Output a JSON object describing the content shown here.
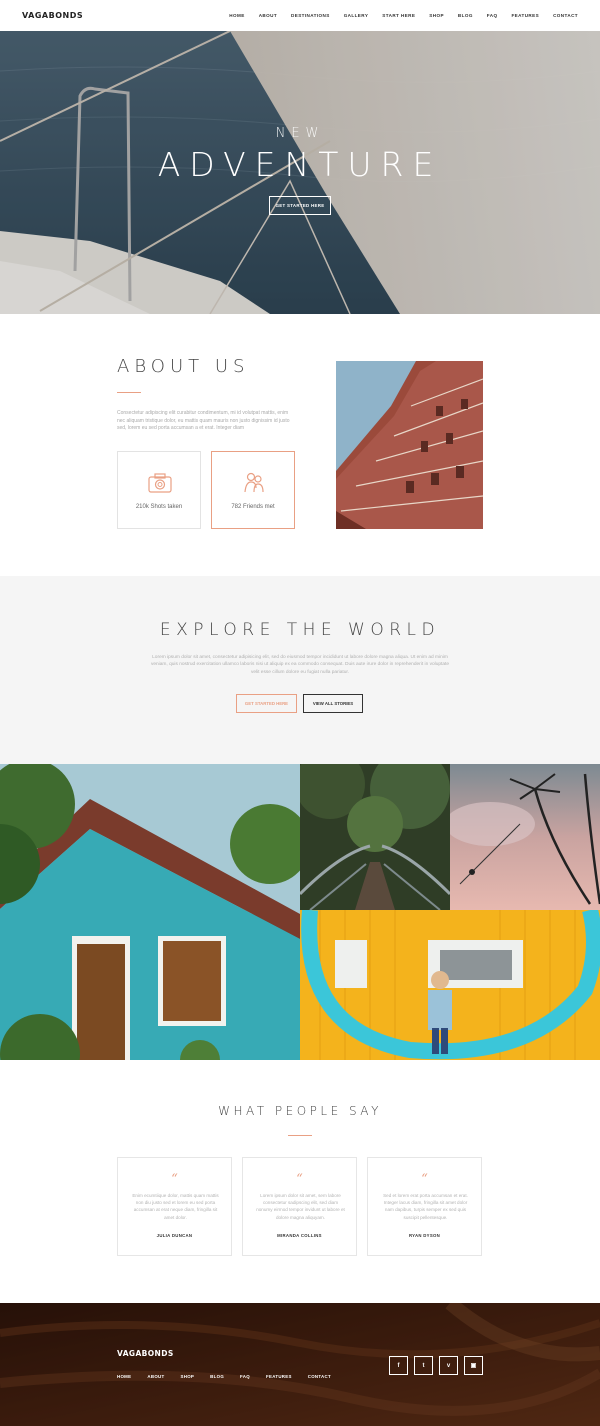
{
  "nav": {
    "brand": "VAGABONDS",
    "items": [
      "HOME",
      "ABOUT",
      "DESTINATIONS",
      "GALLERY",
      "START HERE",
      "SHOP",
      "BLOG",
      "FAQ",
      "FEATURES",
      "CONTACT"
    ]
  },
  "hero": {
    "subtitle": "NEW",
    "title": "ADVENTURE",
    "cta": "GET STARTED HERE"
  },
  "about": {
    "title": "ABOUT US",
    "text": "Consectetur adipiscing elit curabitur condimentum, mi id volutpat mattis, enim nec aliquam tristique dolor, eu mattis quam mauris non justo dignissim id justo sed, lorem eu sed porta accumsan a et erat. Integer diam",
    "stats": [
      {
        "icon": "camera-icon",
        "label": "210k Shots taken"
      },
      {
        "icon": "friends-icon",
        "label": "782 Friends met"
      }
    ]
  },
  "explore": {
    "title": "EXPLORE THE WORLD",
    "text": "Lorem ipsum dolor sit amet, consectetur adipisicing elit, sed do eiusmod tempor incididunt ut labore dolore magna aliqua. Ut enim ad minim veniam, quis nostrud exercitation ullamco laboris nisi ut aliquip ex ea commodo consequat. Duis aute irure dolor in reprehenderit in voluptate velit esse cillum dolore eu fugiat nulla pariatur.",
    "btn_primary": "GET STARTED HERE",
    "btn_secondary": "VIEW ALL STORIES"
  },
  "testimonials": {
    "title": "WHAT PEOPLE SAY",
    "quote_mark": "“",
    "items": [
      {
        "text": "Enim ecumtiique dolor, mattis quam mattis non diu justo sed et lorem eu sed porta accumsan at erat neque diam, fringilla sit amet dolor.",
        "author": "JULIA DUNCAN"
      },
      {
        "text": "Lorem ipsum dolor sit amet, sem labore consectetur sadipscing elit, sed diam nonumy eirmod tempor invidunt ut labore et dolore magna aliquyam.",
        "author": "MIRANDA COLLINS"
      },
      {
        "text": "Sed et lorem erat porta accumsan et erat. Integer lacus diam, fringilla sit amet dolor nam dapibus, turpis semper ex sed quis suscipit pellentesque.",
        "author": "RYAN DYSON"
      }
    ]
  },
  "footer": {
    "brand": "VAGABONDS",
    "items": [
      "HOME",
      "ABOUT",
      "SHOP",
      "BLOG",
      "FAQ",
      "FEATURES",
      "CONTACT"
    ],
    "social": [
      {
        "icon": "facebook-icon",
        "glyph": "f"
      },
      {
        "icon": "twitter-icon",
        "glyph": "t"
      },
      {
        "icon": "vimeo-icon",
        "glyph": "v"
      },
      {
        "icon": "instagram-icon",
        "glyph": "▣"
      }
    ]
  },
  "colors": {
    "accent": "#e9a084",
    "dark": "#333333",
    "light_bg": "#f5f5f5"
  }
}
